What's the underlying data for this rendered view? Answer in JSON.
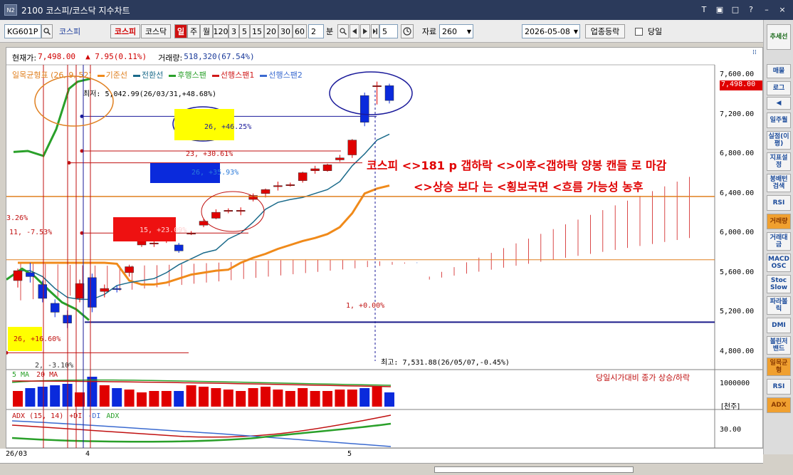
{
  "window": {
    "title": "2100 코스피/코스닥 지수차트",
    "logo": "N2"
  },
  "window_buttons": [
    "T",
    "▣",
    "□",
    "?",
    "–",
    "×"
  ],
  "toolbar": {
    "code": "KG601P",
    "market": "코스피",
    "btn_kospi": "코스피",
    "btn_kosdaq": "코스닥",
    "period_day": "일",
    "period_week": "주",
    "period_month": "월",
    "minutes": [
      "120",
      "3",
      "5",
      "15",
      "20",
      "30",
      "60"
    ],
    "minute_value": "2",
    "minute_unit": "분",
    "step_value": "5",
    "data_label": "자료",
    "data_value": "260",
    "date": "2026-05-08",
    "sector_btn": "업종등락",
    "today_label": "당일"
  },
  "info": {
    "current_label": "현재가:",
    "current_value": "7,498.00",
    "change": "▲ 7.95(0.11%)",
    "volume_label": "거래량:",
    "volume_value": "518,320(67.54%)"
  },
  "legend": {
    "ichimoku": "일목균형표 (26, 9, 52)",
    "items": [
      {
        "label": "기준선",
        "color": "#f08a1a"
      },
      {
        "label": "전환선",
        "color": "#1a6a8a"
      },
      {
        "label": "후행스팬",
        "color": "#2aa02a"
      },
      {
        "label": "선행스팬1",
        "color": "#d01a1a"
      },
      {
        "label": "선행스팬2",
        "color": "#3a6ad0"
      }
    ]
  },
  "annotations": {
    "low": "최저: 5,042.99(26/03/31,+48.68%)",
    "high": "최고: 7,531.88(26/05/07,-0.45%)",
    "a1": "26, +46.25%",
    "a2": "23, +30.61%",
    "a3": "26, +35.93%",
    "a4": "15, +23.09%",
    "a5": "11, -7.53%",
    "a6": "3.26%",
    "a7": "1, +0.00%",
    "a8": "26, +16.60%",
    "a9": "2, -3.10%",
    "comment1": "코스피 <>181 p 갭하락 <>이후<갭하락 양봉 캔들 로 마감",
    "comment2": "<>상승 보다 는 <횡보국면 <흐름 가능성 농후"
  },
  "price_axis": {
    "ticks": [
      "7,600.00",
      "7,200.00",
      "6,800.00",
      "6,400.00",
      "6,000.00",
      "5,600.00",
      "5,200.00",
      "4,800.00"
    ],
    "current_tag": "7,498.00"
  },
  "volume_panel": {
    "ma5": "5 MA",
    "ma20": "20 MA",
    "note": "당일시가대비 종가 상승/하락",
    "axis": "1000000",
    "unit": "[천주]"
  },
  "adx_panel": {
    "title": "ADX (15, 14)",
    "plus_di": "+DI",
    "minus_di": "-DI",
    "adx": "ADX",
    "axis": "30.00"
  },
  "x_axis": {
    "labels": [
      "26/03",
      "4",
      "5"
    ]
  },
  "rightbar": {
    "items": [
      "추세선",
      "매물",
      "로그",
      "◀",
      "일주월",
      "실점(이평)",
      "지표설정",
      "봉배턴검색",
      "RSI",
      "거래량",
      "거래대금",
      "MACD OSC",
      "Stoc Slow",
      "파라볼릭",
      "DMI",
      "볼린저밴드",
      "일목균형",
      "RSI",
      "ADX"
    ]
  },
  "chart_data": {
    "type": "candlestick",
    "ylim": [
      4600,
      7700
    ],
    "candles": [
      {
        "o": 5520,
        "h": 5640,
        "l": 5450,
        "c": 5620
      },
      {
        "o": 5600,
        "h": 5700,
        "l": 5500,
        "c": 5560
      },
      {
        "o": 5480,
        "h": 5520,
        "l": 5300,
        "c": 5340
      },
      {
        "o": 5290,
        "h": 5330,
        "l": 5150,
        "c": 5200
      },
      {
        "o": 5170,
        "h": 5220,
        "l": 5040,
        "c": 5090
      },
      {
        "o": 5340,
        "h": 5530,
        "l": 5300,
        "c": 5490
      },
      {
        "o": 5550,
        "h": 5590,
        "l": 5200,
        "c": 5250
      },
      {
        "o": 5410,
        "h": 5480,
        "l": 5350,
        "c": 5440
      },
      {
        "o": 5440,
        "h": 5470,
        "l": 5400,
        "c": 5430
      },
      {
        "o": 5600,
        "h": 5680,
        "l": 5560,
        "c": 5660
      },
      {
        "o": 5880,
        "h": 5960,
        "l": 5860,
        "c": 5950
      },
      {
        "o": 5890,
        "h": 5940,
        "l": 5860,
        "c": 5900
      },
      {
        "o": 5920,
        "h": 5960,
        "l": 5900,
        "c": 5940
      },
      {
        "o": 5880,
        "h": 5900,
        "l": 5800,
        "c": 5820
      },
      {
        "o": 5990,
        "h": 6020,
        "l": 5980,
        "c": 6000
      },
      {
        "o": 6080,
        "h": 6140,
        "l": 6060,
        "c": 6120
      },
      {
        "o": 6150,
        "h": 6240,
        "l": 6140,
        "c": 6210
      },
      {
        "o": 6220,
        "h": 6250,
        "l": 6200,
        "c": 6230
      },
      {
        "o": 6220,
        "h": 6260,
        "l": 6180,
        "c": 6230
      },
      {
        "o": 6340,
        "h": 6400,
        "l": 6320,
        "c": 6380
      },
      {
        "o": 6400,
        "h": 6450,
        "l": 6360,
        "c": 6440
      },
      {
        "o": 6470,
        "h": 6520,
        "l": 6430,
        "c": 6480
      },
      {
        "o": 6480,
        "h": 6510,
        "l": 6470,
        "c": 6490
      },
      {
        "o": 6530,
        "h": 6620,
        "l": 6510,
        "c": 6610
      },
      {
        "o": 6630,
        "h": 6680,
        "l": 6600,
        "c": 6650
      },
      {
        "o": 6630,
        "h": 6700,
        "l": 6620,
        "c": 6690
      },
      {
        "o": 6740,
        "h": 6790,
        "l": 6720,
        "c": 6760
      },
      {
        "o": 6790,
        "h": 6950,
        "l": 6760,
        "c": 6940
      },
      {
        "o": 7390,
        "h": 7420,
        "l": 7080,
        "c": 7120
      },
      {
        "o": 7490,
        "h": 7531,
        "l": 7300,
        "c": 7490
      },
      {
        "o": 7490,
        "h": 7510,
        "l": 7310,
        "c": 7340
      }
    ],
    "kijun": [
      5700,
      5700,
      5700,
      5700,
      5700,
      5700,
      5700,
      5700,
      5690,
      5520,
      5480,
      5480,
      5500,
      5540,
      5580,
      5600,
      5620,
      5630,
      5700,
      5750,
      5790,
      5840,
      5880,
      5920,
      5950,
      5990,
      6060,
      6200,
      6400,
      6450,
      6480
    ],
    "tenkan": [
      5620,
      5620,
      5560,
      5440,
      5350,
      5330,
      5330,
      5380,
      5470,
      5500,
      5520,
      5540,
      5600,
      5680,
      5740,
      5800,
      5830,
      5940,
      6000,
      6110,
      6240,
      6310,
      6340,
      6360,
      6400,
      6440,
      6520,
      6680,
      6800,
      6940,
      7000
    ],
    "chikou": [
      5480,
      5580,
      5650,
      5550,
      5300,
      5250,
      5360,
      5230,
      5400,
      5420,
      5430,
      5530
    ]
  }
}
